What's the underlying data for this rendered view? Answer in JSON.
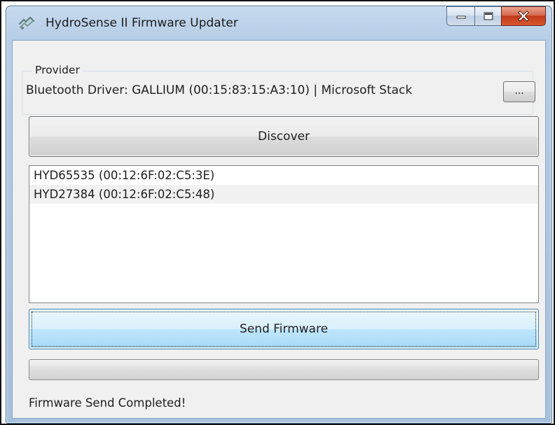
{
  "window": {
    "title": "HydroSense II Firmware Updater",
    "icon": "hydrosense-app-icon",
    "caption_buttons": [
      "minimize-icon",
      "maximize-icon",
      "close-icon"
    ]
  },
  "provider": {
    "group_label": "Provider",
    "driver_text": "Bluetooth Driver: GALLIUM (00:15:83:15:A3:10) | Microsoft Stack",
    "browse_label": "..."
  },
  "discover_label": "Discover",
  "devices": [
    "HYD65535  (00:12:6F:02:C5:3E)",
    "HYD27384  (00:12:6F:02:C5:48)"
  ],
  "send_firmware_label": "Send Firmware",
  "progress": {
    "value_percent": 0
  },
  "status_text": "Firmware Send Completed!",
  "colors": {
    "window_frame": "#a6c1dd",
    "close_button": "#c2391c",
    "send_button_accent": "#bee6fd",
    "client_background": "#f0f0f0"
  }
}
